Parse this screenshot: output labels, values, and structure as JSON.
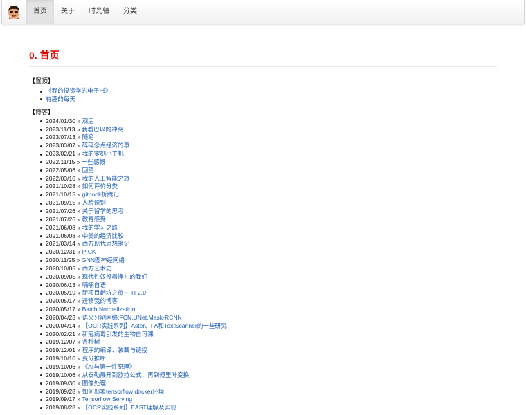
{
  "nav": {
    "items": [
      {
        "label": "首页",
        "active": true
      },
      {
        "label": "关于",
        "active": false
      },
      {
        "label": "时光轴",
        "active": false
      },
      {
        "label": "分类",
        "active": false
      }
    ]
  },
  "page": {
    "title": "0. 首页",
    "pinned_heading": "【置顶】",
    "pinned": [
      "《我的投资学的电子书》",
      "有趣的每天"
    ],
    "blog_heading": "【博客】",
    "separator": "»",
    "posts": [
      {
        "date": "2024/01/30",
        "title": "观后"
      },
      {
        "date": "2023/11/13",
        "title": "我看巴以的冲突"
      },
      {
        "date": "2023/07/13",
        "title": "随笔"
      },
      {
        "date": "2023/03/07",
        "title": "碎碎念点经济的事"
      },
      {
        "date": "2023/02/21",
        "title": "我的零刻小主机"
      },
      {
        "date": "2022/11/15",
        "title": "一些感慨"
      },
      {
        "date": "2022/05/06",
        "title": "回望"
      },
      {
        "date": "2022/03/10",
        "title": "我的人工智能之旅"
      },
      {
        "date": "2021/10/28",
        "title": "如何评价分类"
      },
      {
        "date": "2021/10/15",
        "title": "gitbook折腾记"
      },
      {
        "date": "2021/09/15",
        "title": "人脸识别"
      },
      {
        "date": "2021/07/26",
        "title": "关于留学的思考"
      },
      {
        "date": "2021/07/26",
        "title": "教育感受"
      },
      {
        "date": "2021/06/08",
        "title": "我的学习之路"
      },
      {
        "date": "2021/06/08",
        "title": "中美的经济比较"
      },
      {
        "date": "2021/03/14",
        "title": "西方现代思想笔记"
      },
      {
        "date": "2020/12/31",
        "title": "PICK"
      },
      {
        "date": "2020/11/25",
        "title": "GNN图神经网络"
      },
      {
        "date": "2020/10/05",
        "title": "西方艺术史"
      },
      {
        "date": "2020/09/05",
        "title": "现代性奴役着挣扎的我们"
      },
      {
        "date": "2020/06/13",
        "title": "喃喃自语"
      },
      {
        "date": "2020/05/19",
        "title": "新项目趟坑之旅 ~ TF2.0"
      },
      {
        "date": "2020/05/17",
        "title": "迁移我的博客"
      },
      {
        "date": "2020/05/17",
        "title": "Batch Normalization"
      },
      {
        "date": "2020/04/23",
        "title": "语义分割网络:FCN,UNet,Mask-RCNN"
      },
      {
        "date": "2020/04/14",
        "title": "【OCR实践系列】Aster、FA和TextScanner的一些研究"
      },
      {
        "date": "2020/02/21",
        "title": "新冠病毒引发的生物自习课"
      },
      {
        "date": "2019/12/07",
        "title": "各种树"
      },
      {
        "date": "2019/12/01",
        "title": "程序的编译、装载与链接"
      },
      {
        "date": "2019/10/10",
        "title": "变分推断"
      },
      {
        "date": "2019/10/06",
        "title": "《AI与第一性原理》"
      },
      {
        "date": "2019/10/06",
        "title": "从泰勒展开到欧拉公式，再到傅里叶变换"
      },
      {
        "date": "2019/09/30",
        "title": "图像处理"
      },
      {
        "date": "2019/09/28",
        "title": "如何部署tensorflow docker环境"
      },
      {
        "date": "2019/09/17",
        "title": "Tensorflow Serving"
      },
      {
        "date": "2019/08/28",
        "title": "【OCR实践系列】EAST理解及实现"
      }
    ]
  },
  "colors": {
    "title": "#e00000",
    "link": "#1f5fb5"
  }
}
